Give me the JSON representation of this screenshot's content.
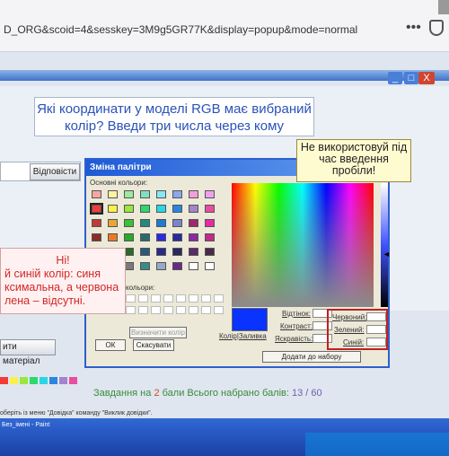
{
  "browser": {
    "url": "D_ORG&scoid=4&sesskey=3M9g5GR77K&display=popup&mode=normal",
    "menu_icon": "more-dots-icon",
    "shield_icon": "shield-icon"
  },
  "window_controls": {
    "minimize": "_",
    "maximize": "□",
    "close": "X"
  },
  "question": {
    "text": "Які координати у моделі RGB має вибраний колір? Введи три числа через кому"
  },
  "tip": {
    "text": "Не використовуй під час введення пробіли!"
  },
  "answer_button": "Відповісти",
  "feedback": {
    "title": "Ні!",
    "text": "й синій колір: синя ксимальна, а червона лена – відсутні."
  },
  "restore_button": "ити матеріал",
  "dialog": {
    "title": "Зміна палітри",
    "basic_colors_label": "Основні кольори:",
    "custom_colors_label": "кольори:",
    "fields": {
      "hue": "Відтінок:",
      "contrast": "Контраст:",
      "brightness": "Яскравість:",
      "red": "Червоний:",
      "green": "Зелений:",
      "blue": "Синій:",
      "color_fill": "Колір|Заливка"
    },
    "buttons": {
      "ok": "ОК",
      "cancel": "Скасувати",
      "add": "Додати до набору",
      "define": "Визначити колір >>"
    },
    "basic_colors": [
      "#f4a6a6",
      "#fbf3a0",
      "#9fe8a0",
      "#7ee0c0",
      "#88e6f5",
      "#8aa8e8",
      "#f0a0d8",
      "#f0a0f0",
      "#f23a3a",
      "#f7f24a",
      "#9be63f",
      "#2ed86c",
      "#29d6e6",
      "#2a86e0",
      "#a285cc",
      "#ea4ca0",
      "#c03a3a",
      "#e8a63a",
      "#38c23a",
      "#228a7a",
      "#1f7ad0",
      "#7a86c8",
      "#9a2a6c",
      "#ea2aa0",
      "#8a2c2c",
      "#e87a2a",
      "#2aaa2a",
      "#2a6a6a",
      "#2a2ae0",
      "#2a2a9a",
      "#8a2aa0",
      "#c02a8a",
      "#5a2a2a",
      "#9a5a2a",
      "#2a6a2a",
      "#2a5a7a",
      "#2a2a8a",
      "#2a2a5a",
      "#5a2a6a",
      "#4a2a4a",
      "#2a2a2a",
      "#8a8a2a",
      "#7a7a7a",
      "#3a8a8a",
      "#9aa8c8",
      "#6a2a8a",
      "#ffffff",
      "#ffffff"
    ],
    "selected_index": 8
  },
  "score": {
    "prefix": "Завдання на",
    "points": "2",
    "middle": "бали Всього набрано балів:",
    "total": "13 / 60"
  },
  "hint": "оберіть із меню \"Довідка\" команду \"Виклик довідки\".",
  "taskbar": {
    "item": "Без_імені - Paint"
  }
}
